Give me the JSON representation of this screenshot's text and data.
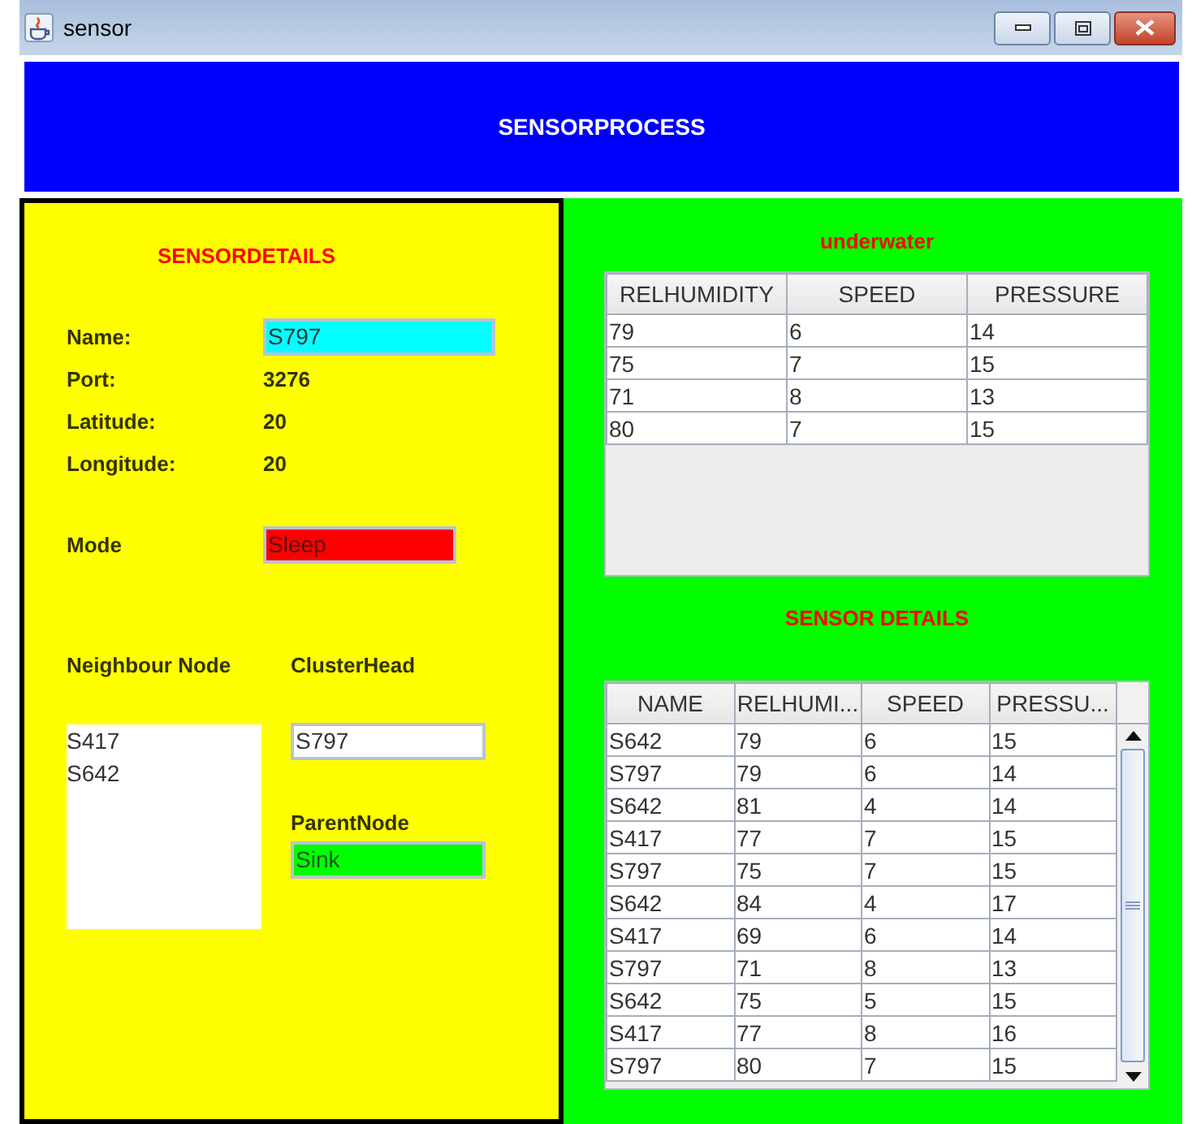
{
  "window": {
    "title": "sensor"
  },
  "header": {
    "title": "SENSORPROCESS"
  },
  "sensor_details": {
    "title": "SENSORDETAILS",
    "fields": [
      {
        "label": "Name:",
        "value": "S797",
        "kind": "field"
      },
      {
        "label": "Port:",
        "value": "3276",
        "kind": "text"
      },
      {
        "label": "Latitude:",
        "value": "20",
        "kind": "text"
      },
      {
        "label": "Longitude:",
        "value": "20",
        "kind": "text"
      }
    ],
    "mode": {
      "label": "Mode",
      "value": "Sleep"
    },
    "neighbour_node": {
      "label": "Neighbour Node",
      "items": [
        "S417",
        "S642"
      ]
    },
    "cluster_head": {
      "label": "ClusterHead",
      "value": "S797"
    },
    "parent_node": {
      "label": "ParentNode",
      "value": "Sink"
    }
  },
  "underwater": {
    "title": "underwater",
    "columns": [
      "RELHUMIDITY",
      "SPEED",
      "PRESSURE"
    ],
    "rows": [
      [
        "79",
        "6",
        "14"
      ],
      [
        "75",
        "7",
        "15"
      ],
      [
        "71",
        "8",
        "13"
      ],
      [
        "80",
        "7",
        "15"
      ]
    ]
  },
  "sensor_table": {
    "title": "SENSOR DETAILS",
    "columns": [
      "NAME",
      "RELHUMI...",
      "SPEED",
      "PRESSU..."
    ],
    "rows": [
      [
        "S642",
        "79",
        "6",
        "15"
      ],
      [
        "S797",
        "79",
        "6",
        "14"
      ],
      [
        "S642",
        "81",
        "4",
        "14"
      ],
      [
        "S417",
        "77",
        "7",
        "15"
      ],
      [
        "S797",
        "75",
        "7",
        "15"
      ],
      [
        "S642",
        "84",
        "4",
        "17"
      ],
      [
        "S417",
        "69",
        "6",
        "14"
      ],
      [
        "S797",
        "71",
        "8",
        "13"
      ],
      [
        "S642",
        "75",
        "5",
        "15"
      ],
      [
        "S417",
        "77",
        "8",
        "16"
      ],
      [
        "S797",
        "80",
        "7",
        "15"
      ]
    ]
  }
}
